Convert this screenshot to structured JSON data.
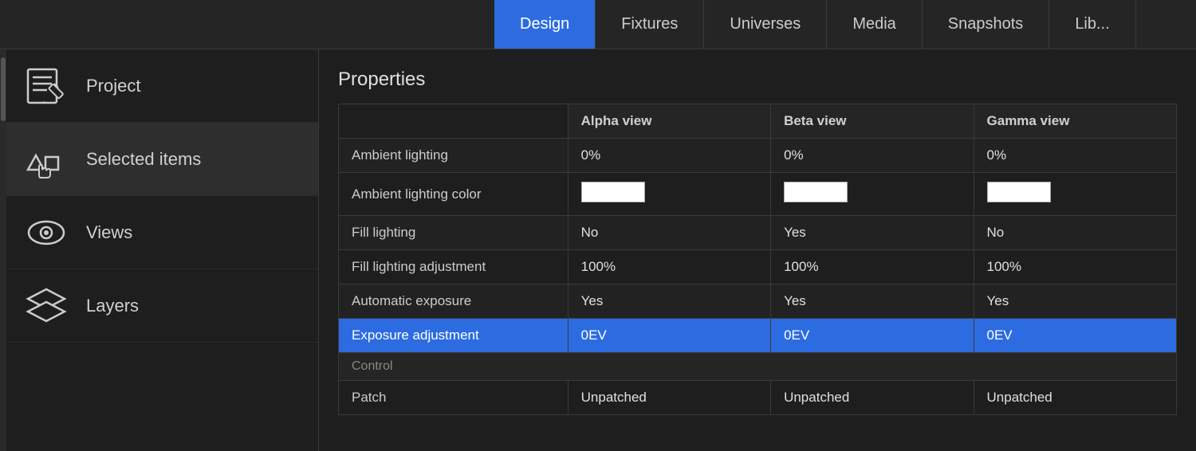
{
  "nav": {
    "tabs": [
      {
        "label": "Design",
        "active": true
      },
      {
        "label": "Fixtures",
        "active": false
      },
      {
        "label": "Universes",
        "active": false
      },
      {
        "label": "Media",
        "active": false
      },
      {
        "label": "Snapshots",
        "active": false
      },
      {
        "label": "Lib...",
        "active": false
      }
    ]
  },
  "sidebar": {
    "items": [
      {
        "label": "Project",
        "icon": "project"
      },
      {
        "label": "Selected items",
        "icon": "selected-items",
        "active": true
      },
      {
        "label": "Views",
        "icon": "views"
      },
      {
        "label": "Layers",
        "icon": "layers"
      }
    ]
  },
  "content": {
    "title": "Properties",
    "table": {
      "headers": [
        "",
        "Alpha view",
        "Beta view",
        "Gamma view"
      ],
      "rows": [
        {
          "label": "Ambient lighting",
          "alpha": "0%",
          "beta": "0%",
          "gamma": "0%",
          "type": "text",
          "highlighted": false
        },
        {
          "label": "Ambient lighting color",
          "alpha": "swatch",
          "beta": "swatch",
          "gamma": "swatch",
          "type": "swatch",
          "highlighted": false
        },
        {
          "label": "Fill lighting",
          "alpha": "No",
          "beta": "Yes",
          "gamma": "No",
          "type": "text",
          "highlighted": false
        },
        {
          "label": "Fill lighting adjustment",
          "alpha": "100%",
          "beta": "100%",
          "gamma": "100%",
          "type": "text",
          "highlighted": false
        },
        {
          "label": "Automatic exposure",
          "alpha": "Yes",
          "beta": "Yes",
          "gamma": "Yes",
          "type": "text",
          "highlighted": false
        },
        {
          "label": "Exposure adjustment",
          "alpha": "0EV",
          "beta": "0EV",
          "gamma": "0EV",
          "type": "text",
          "highlighted": true
        },
        {
          "label": "Control",
          "type": "section",
          "highlighted": false
        },
        {
          "label": "Patch",
          "alpha": "Unpatched",
          "beta": "Unpatched",
          "gamma": "Unpatched",
          "type": "text",
          "highlighted": false
        }
      ]
    }
  }
}
